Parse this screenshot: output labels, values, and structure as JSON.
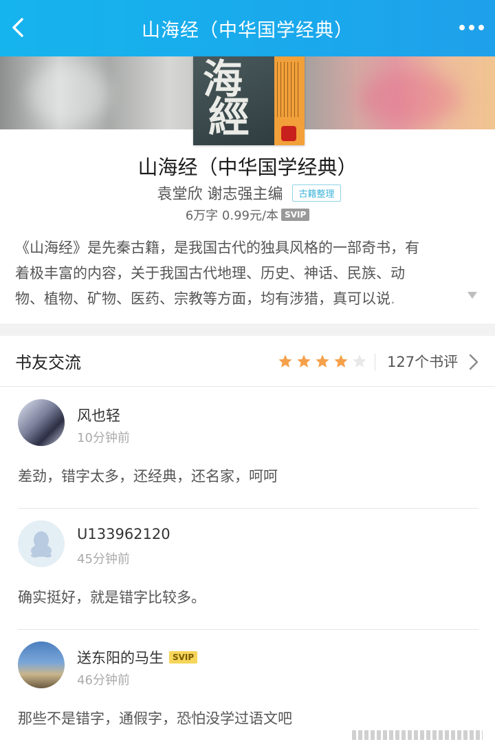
{
  "header": {
    "title": "山海经（中华国学经典）",
    "back_icon": "chevron-left-icon",
    "more_icon": "more-dots-icon"
  },
  "book": {
    "title": "山海经（中华国学经典）",
    "author": "袁堂欣 谢志强主编",
    "tag": "古籍整理",
    "meta": "6万字 0.99元/本",
    "meta_badge": "SVIP",
    "cover_text_1": "海",
    "cover_text_2": "經",
    "description_lines": [
      "《山海经》是先秦古籍，是我国古代的独具风格的一部奇书，有",
      "着极丰富的内容，关于我国古代地理、历史、神话、民族、动",
      "物、植物、矿物、医药、宗教等方面，均有涉猎，真可以说",
      "."
    ]
  },
  "section": {
    "title": "书友交流",
    "rating": 4,
    "rating_max": 5,
    "review_count": "127个书评",
    "accent_color": "#f5a04a"
  },
  "reviews": [
    {
      "user": "风也轻",
      "time": "10分钟前",
      "text": "差劲，错字太多，还经典，还名家，呵呵",
      "badge": ""
    },
    {
      "user": "U133962120",
      "time": "45分钟前",
      "text": "确实挺好，就是错字比较多。",
      "badge": ""
    },
    {
      "user": "送东阳的马生",
      "time": "46分钟前",
      "text": "那些不是错字，通假字，恐怕没学过语文吧",
      "badge": "SVIP"
    }
  ]
}
